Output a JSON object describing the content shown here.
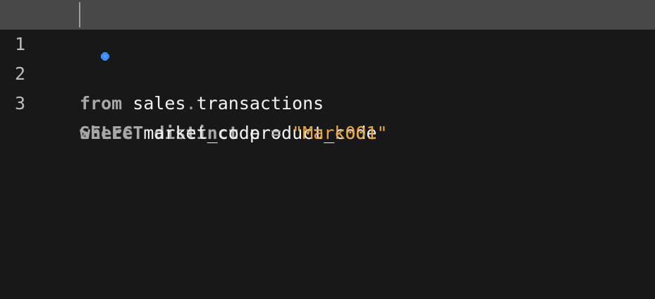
{
  "editor": {
    "lines": [
      {
        "number": "1",
        "tokens": {
          "kw1": "SELECT",
          "sp1": " ",
          "kw2": "distinct",
          "sp2": " ",
          "id1": "product_code"
        }
      },
      {
        "number": "2",
        "tokens": {
          "kw1": "from",
          "sp1": " ",
          "id1": "sales",
          "op1": ".",
          "id2": "transactions"
        }
      },
      {
        "number": "3",
        "tokens": {
          "kw1": "where",
          "sp1": " ",
          "id1": "market_code",
          "sp2": " ",
          "op1": "=",
          "sp3": " ",
          "str1": "\"Mark001\""
        }
      }
    ],
    "marker_icon": "gear-dot-icon",
    "colors": {
      "background": "#181818",
      "active_line": "#484848",
      "keyword": "#a7a7a7",
      "identifier": "#f2f2f2",
      "string": "#e9a43f",
      "marker": "#3d8cff"
    }
  }
}
